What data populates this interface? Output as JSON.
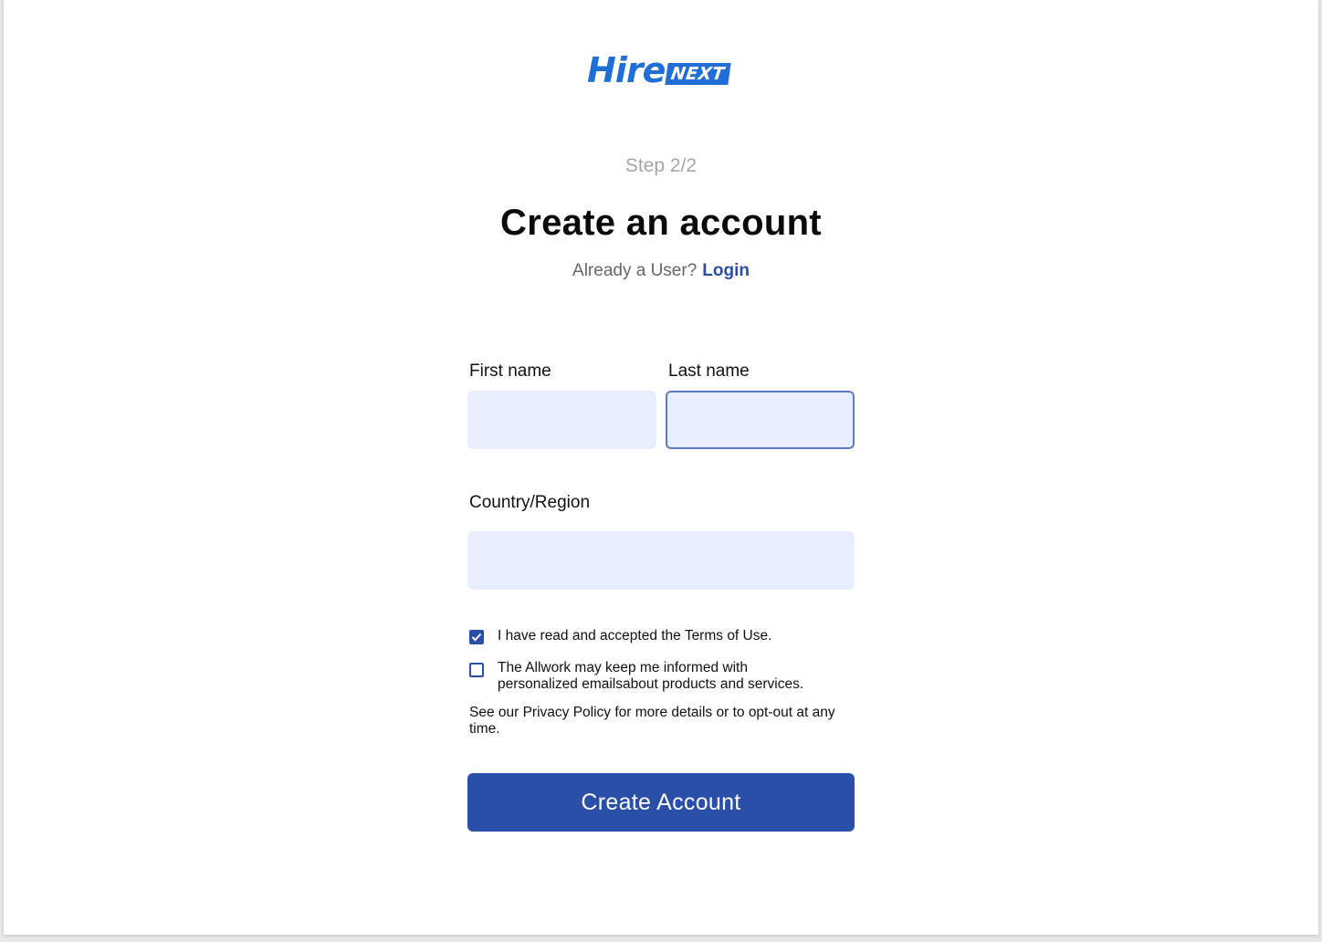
{
  "logo": {
    "part1": "Hire",
    "part2": "NEXT"
  },
  "header": {
    "step": "Step 2/2",
    "title": "Create an account",
    "already_user": "Already a User?",
    "login_link": "Login"
  },
  "form": {
    "first_name": {
      "label": "First name",
      "value": ""
    },
    "last_name": {
      "label": "Last name",
      "value": ""
    },
    "country": {
      "label": "Country/Region",
      "value": ""
    },
    "terms": {
      "label": "I have read and accepted the Terms of Use.",
      "checked": true
    },
    "marketing": {
      "label": "The Allwork may keep me informed with personalized emailsabout products and services.",
      "checked": false
    },
    "privacy_note": "See our Privacy Policy for more details or to opt-out at any time.",
    "submit_label": "Create Account"
  },
  "colors": {
    "brand": "#1f6fd6",
    "primary": "#2a4fa8",
    "input_bg": "#e8eefd"
  }
}
